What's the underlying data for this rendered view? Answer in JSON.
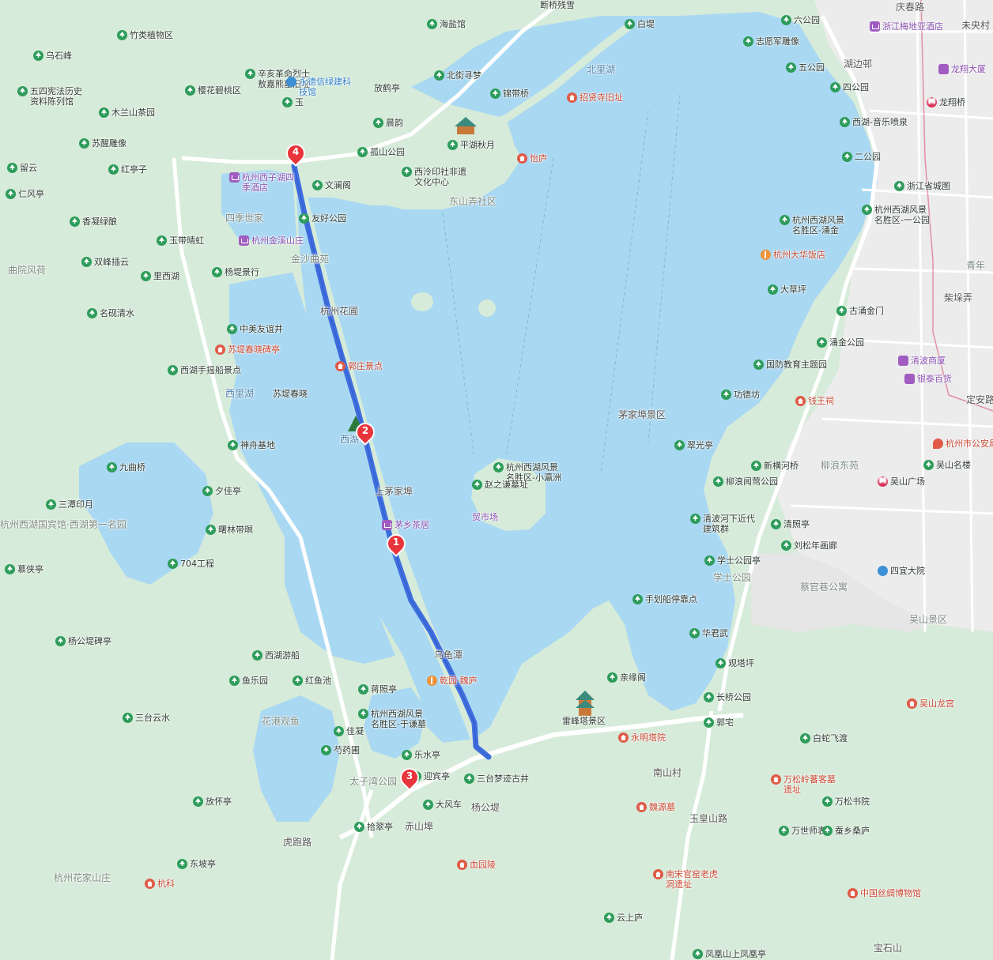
{
  "map": {
    "route_color": "#3f6fe0",
    "water_color": "#a9d8f3",
    "land_color": "#d6ebd9",
    "urban_color": "#ececec",
    "markers": [
      {
        "label": "1"
      },
      {
        "label": "2"
      },
      {
        "label": "3"
      },
      {
        "label": "4"
      }
    ],
    "labels": [
      {
        "text": "庆春路",
        "icon": "none",
        "style": "road"
      },
      {
        "text": "未央村",
        "icon": "none",
        "style": "road"
      },
      {
        "text": "六公园",
        "icon": "park",
        "style": ""
      },
      {
        "text": "浙江梅地亚酒店",
        "icon": "hotel",
        "style": "purple"
      },
      {
        "text": "志愿军雕像",
        "icon": "park",
        "style": ""
      },
      {
        "text": "湖边邨",
        "icon": "none",
        "style": "road"
      },
      {
        "text": "五公园",
        "icon": "park",
        "style": ""
      },
      {
        "text": "龙翔大厦",
        "icon": "mall",
        "style": "purple"
      },
      {
        "text": "四公园",
        "icon": "park",
        "style": ""
      },
      {
        "text": "龙翔桥",
        "icon": "metro",
        "style": ""
      },
      {
        "text": "西湖-音乐喷泉",
        "icon": "park",
        "style": ""
      },
      {
        "text": "二公园",
        "icon": "park",
        "style": ""
      },
      {
        "text": "浙江省城图",
        "icon": "park",
        "style": ""
      },
      {
        "text": "杭州西湖风景名胜区-一公园",
        "icon": "park",
        "style": ""
      },
      {
        "text": "杭州西湖风景名胜区-涌金",
        "icon": "park",
        "style": ""
      },
      {
        "text": "杭州大华饭店",
        "icon": "food",
        "style": "red"
      },
      {
        "text": "青年",
        "icon": "none",
        "style": "gray"
      },
      {
        "text": "大草坪",
        "icon": "park",
        "style": ""
      },
      {
        "text": "古涌金门",
        "icon": "park",
        "style": ""
      },
      {
        "text": "柴垛弄",
        "icon": "none",
        "style": "road"
      },
      {
        "text": "涌金公园",
        "icon": "park",
        "style": ""
      },
      {
        "text": "清波商厦",
        "icon": "mall",
        "style": "purple"
      },
      {
        "text": "国防教育主题园",
        "icon": "park",
        "style": ""
      },
      {
        "text": "银泰百货",
        "icon": "mall",
        "style": "purple"
      },
      {
        "text": "功德坊",
        "icon": "park",
        "style": ""
      },
      {
        "text": "钱王祠",
        "icon": "poi",
        "style": "red"
      },
      {
        "text": "定安路",
        "icon": "none",
        "style": "road"
      },
      {
        "text": "杭州市公安局",
        "icon": "gov",
        "style": "red"
      },
      {
        "text": "翠光亭",
        "icon": "park",
        "style": ""
      },
      {
        "text": "新横河桥",
        "icon": "park",
        "style": ""
      },
      {
        "text": "柳浪东苑",
        "icon": "none",
        "style": "gray"
      },
      {
        "text": "吴山名楼",
        "icon": "park",
        "style": ""
      },
      {
        "text": "柳浪闻莺公园",
        "icon": "park",
        "style": ""
      },
      {
        "text": "吴山广场",
        "icon": "metro",
        "style": ""
      },
      {
        "text": "清波河下近代建筑群",
        "icon": "park",
        "style": ""
      },
      {
        "text": "清照亭",
        "icon": "park",
        "style": ""
      },
      {
        "text": "刘松年画廊",
        "icon": "park",
        "style": ""
      },
      {
        "text": "学士公园亭",
        "icon": "park",
        "style": ""
      },
      {
        "text": "四宜大院",
        "icon": "school",
        "style": ""
      },
      {
        "text": "学士公园",
        "icon": "none",
        "style": "gray"
      },
      {
        "text": "蔡官巷公寓",
        "icon": "none",
        "style": "gray"
      },
      {
        "text": "手划船停靠点",
        "icon": "park",
        "style": ""
      },
      {
        "text": "吴山景区",
        "icon": "none",
        "style": "gray"
      },
      {
        "text": "华君武",
        "icon": "park",
        "style": ""
      },
      {
        "text": "观塔坪",
        "icon": "park",
        "style": ""
      },
      {
        "text": "亲缘阁",
        "icon": "park",
        "style": ""
      },
      {
        "text": "长桥公园",
        "icon": "park",
        "style": ""
      },
      {
        "text": "吴山龙宫",
        "icon": "poi",
        "style": "red"
      },
      {
        "text": "雷峰塔景区",
        "icon": "none",
        "style": ""
      },
      {
        "text": "郭宅",
        "icon": "park",
        "style": ""
      },
      {
        "text": "永明塔院",
        "icon": "poi",
        "style": "red"
      },
      {
        "text": "白蛇飞渡",
        "icon": "park",
        "style": ""
      },
      {
        "text": "南山村",
        "icon": "none",
        "style": "road"
      },
      {
        "text": "万松岭蕃客墓遗址",
        "icon": "poi",
        "style": "red"
      },
      {
        "text": "万松书院",
        "icon": "park",
        "style": ""
      },
      {
        "text": "魏源墓",
        "icon": "poi",
        "style": "red"
      },
      {
        "text": "玉皇山路",
        "icon": "none",
        "style": "road"
      },
      {
        "text": "万世师表",
        "icon": "park",
        "style": ""
      },
      {
        "text": "蚕乡桑庐",
        "icon": "park",
        "style": ""
      },
      {
        "text": "南宋官窑老虎洞遗址",
        "icon": "poi",
        "style": "red"
      },
      {
        "text": "中国丝绸博物馆",
        "icon": "poi",
        "style": "red"
      },
      {
        "text": "云上庐",
        "icon": "park",
        "style": ""
      },
      {
        "text": "凤凰山上凤凰亭",
        "icon": "park",
        "style": ""
      },
      {
        "text": "宝石山",
        "icon": "none",
        "style": "road"
      },
      {
        "text": "海盐馆",
        "icon": "park",
        "style": ""
      },
      {
        "text": "断桥残雪",
        "icon": "none",
        "style": ""
      },
      {
        "text": "白堤",
        "icon": "park",
        "style": ""
      },
      {
        "text": "北里湖",
        "icon": "none",
        "style": "water"
      },
      {
        "text": "锦带桥",
        "icon": "park",
        "style": ""
      },
      {
        "text": "招贤寺旧址",
        "icon": "poi",
        "style": "red"
      },
      {
        "text": "北街寻梦",
        "icon": "park",
        "style": ""
      },
      {
        "text": "放鹤亭",
        "icon": "none",
        "style": ""
      },
      {
        "text": "平湖秋月",
        "icon": "park",
        "style": ""
      },
      {
        "text": "怡庐",
        "icon": "poi",
        "style": "red"
      },
      {
        "text": "晨韵",
        "icon": "park",
        "style": ""
      },
      {
        "text": "孤山公园",
        "icon": "park",
        "style": ""
      },
      {
        "text": "西泠印社非遗文化中心",
        "icon": "park",
        "style": ""
      },
      {
        "text": "文澜阁",
        "icon": "park",
        "style": ""
      },
      {
        "text": "东山弄社区",
        "icon": "none",
        "style": "gray"
      },
      {
        "text": "竹类植物区",
        "icon": "park",
        "style": ""
      },
      {
        "text": "乌石峰",
        "icon": "park",
        "style": ""
      },
      {
        "text": "辛亥革命烈士敖嘉熊墓旧址",
        "icon": "park",
        "style": ""
      },
      {
        "text": "永德信绿建科技馆",
        "icon": "school",
        "style": "blue"
      },
      {
        "text": "樱花碧桃区",
        "icon": "park",
        "style": ""
      },
      {
        "text": "五四宪法历史资料陈列馆",
        "icon": "park",
        "style": ""
      },
      {
        "text": "玉",
        "icon": "park",
        "style": ""
      },
      {
        "text": "木兰山茶园",
        "icon": "park",
        "style": ""
      },
      {
        "text": "苏醒雕像",
        "icon": "park",
        "style": ""
      },
      {
        "text": "留云",
        "icon": "park",
        "style": ""
      },
      {
        "text": "杭州西子湖四季酒店",
        "icon": "hotel",
        "style": "purple"
      },
      {
        "text": "红亭子",
        "icon": "park",
        "style": ""
      },
      {
        "text": "仁风亭",
        "icon": "park",
        "style": ""
      },
      {
        "text": "友好公园",
        "icon": "park",
        "style": ""
      },
      {
        "text": "四季世家",
        "icon": "none",
        "style": "gray"
      },
      {
        "text": "香凝绿酿",
        "icon": "park",
        "style": ""
      },
      {
        "text": "杭州金溪山庄",
        "icon": "hotel",
        "style": "purple"
      },
      {
        "text": "玉带晴虹",
        "icon": "park",
        "style": ""
      },
      {
        "text": "金沙曲苑",
        "icon": "none",
        "style": "gray"
      },
      {
        "text": "双峰插云",
        "icon": "park",
        "style": ""
      },
      {
        "text": "曲院风荷",
        "icon": "none",
        "style": "gray"
      },
      {
        "text": "杨堤景行",
        "icon": "park",
        "style": ""
      },
      {
        "text": "里西湖",
        "icon": "park",
        "style": ""
      },
      {
        "text": "杭州花圃",
        "icon": "none",
        "style": "road"
      },
      {
        "text": "名砚清水",
        "icon": "park",
        "style": ""
      },
      {
        "text": "中美友谊井",
        "icon": "park",
        "style": ""
      },
      {
        "text": "苏堤春晓碑亭",
        "icon": "poi",
        "style": "red"
      },
      {
        "text": "郭庄景点",
        "icon": "poi",
        "style": "red"
      },
      {
        "text": "西湖手摇船景点",
        "icon": "park",
        "style": ""
      },
      {
        "text": "西里湖",
        "icon": "none",
        "style": "water"
      },
      {
        "text": "苏堤春晓",
        "icon": "none",
        "style": ""
      },
      {
        "text": "西湖",
        "icon": "none",
        "style": "water"
      },
      {
        "text": "神舟基地",
        "icon": "park",
        "style": ""
      },
      {
        "text": "茅家埠景区",
        "icon": "none",
        "style": "road"
      },
      {
        "text": "九曲桥",
        "icon": "park",
        "style": ""
      },
      {
        "text": "杭州西湖风景名胜区-小瀛洲",
        "icon": "park",
        "style": ""
      },
      {
        "text": "赵之谦墓址",
        "icon": "park",
        "style": ""
      },
      {
        "text": "夕佳亭",
        "icon": "park",
        "style": ""
      },
      {
        "text": "上茅家埠",
        "icon": "none",
        "style": "road"
      },
      {
        "text": "三潭印月",
        "icon": "park",
        "style": ""
      },
      {
        "text": "贸市场",
        "icon": "none",
        "style": "purple"
      },
      {
        "text": "杭州西湖国宾馆·西湖第一名园",
        "icon": "none",
        "style": "gray"
      },
      {
        "text": "曙林带暝",
        "icon": "park",
        "style": ""
      },
      {
        "text": "茅乡茶居",
        "icon": "hotel",
        "style": "purple"
      },
      {
        "text": "慕侠亭",
        "icon": "park",
        "style": ""
      },
      {
        "text": "704工程",
        "icon": "park",
        "style": ""
      },
      {
        "text": "杨公堤碑亭",
        "icon": "park",
        "style": ""
      },
      {
        "text": "西湖游船",
        "icon": "park",
        "style": ""
      },
      {
        "text": "乌龟潭",
        "icon": "none",
        "style": "road"
      },
      {
        "text": "鱼乐园",
        "icon": "park",
        "style": ""
      },
      {
        "text": "红鱼池",
        "icon": "park",
        "style": ""
      },
      {
        "text": "蒋照亭",
        "icon": "park",
        "style": ""
      },
      {
        "text": "乾园·魏庐",
        "icon": "food",
        "style": "red"
      },
      {
        "text": "杭州西湖风景名胜区-于谦墓",
        "icon": "park",
        "style": ""
      },
      {
        "text": "三台云水",
        "icon": "park",
        "style": ""
      },
      {
        "text": "花港观鱼",
        "icon": "none",
        "style": "gray"
      },
      {
        "text": "佳凝",
        "icon": "park",
        "style": ""
      },
      {
        "text": "芍药圃",
        "icon": "park",
        "style": ""
      },
      {
        "text": "乐水亭",
        "icon": "park",
        "style": ""
      },
      {
        "text": "迎宾亭",
        "icon": "park",
        "style": ""
      },
      {
        "text": "三台梦迹古井",
        "icon": "park",
        "style": ""
      },
      {
        "text": "放怀亭",
        "icon": "park",
        "style": ""
      },
      {
        "text": "大风车",
        "icon": "park",
        "style": ""
      },
      {
        "text": "杨公堤",
        "icon": "none",
        "style": "road"
      },
      {
        "text": "太子湾公园",
        "icon": "none",
        "style": "gray"
      },
      {
        "text": "赤山埠",
        "icon": "none",
        "style": "road"
      },
      {
        "text": "虎跑路",
        "icon": "none",
        "style": "road"
      },
      {
        "text": "拾翠亭",
        "icon": "park",
        "style": ""
      },
      {
        "text": "血园陵",
        "icon": "poi",
        "style": "red"
      },
      {
        "text": "杭州花家山庄",
        "icon": "none",
        "style": "gray"
      },
      {
        "text": "东坡亭",
        "icon": "park",
        "style": ""
      },
      {
        "text": "杭科",
        "icon": "poi",
        "style": "red"
      }
    ]
  }
}
